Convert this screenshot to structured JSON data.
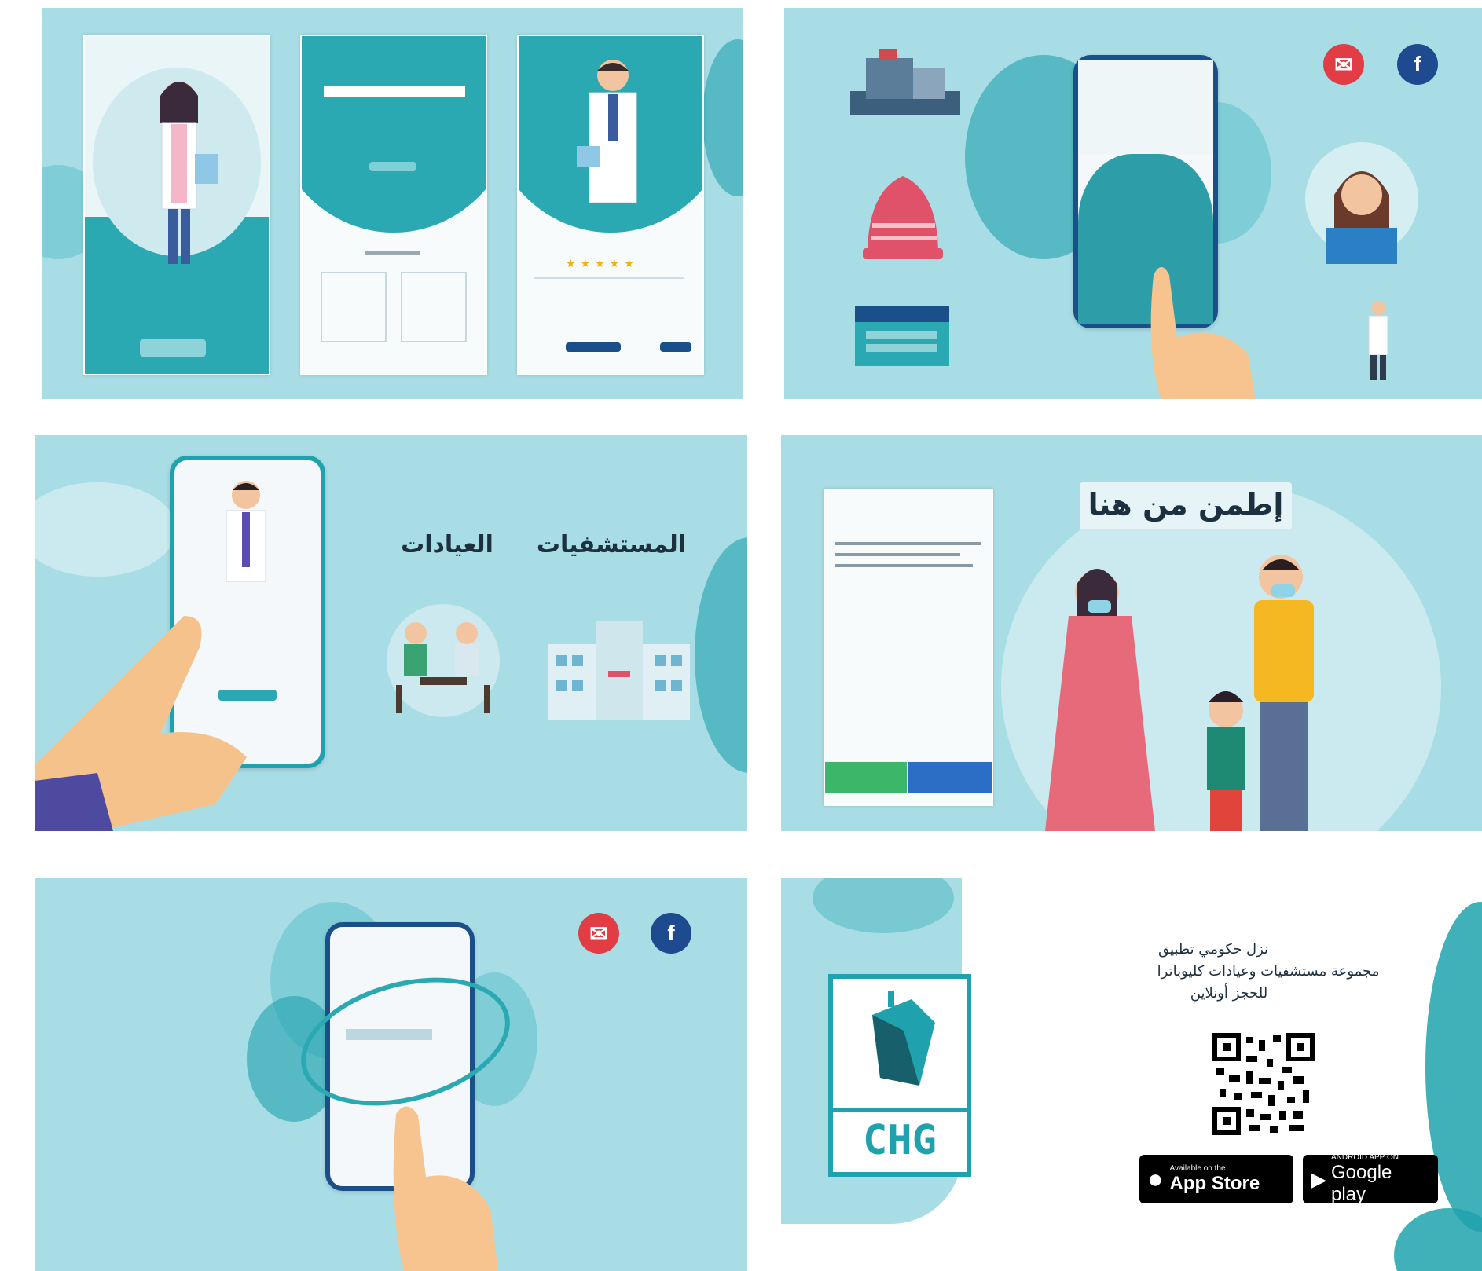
{
  "panel3": {
    "label_hospitals": "المستشفيات",
    "label_clinics": "العيادات"
  },
  "panel4": {
    "headline": "إطمن من هنا"
  },
  "panel6": {
    "line1": "نزل حكومي تطبيق",
    "line2": "مجموعة مستشفيات وعيادات كليوباترا",
    "line3": "للحجز أونلاين",
    "logo_text": "CHG",
    "app_store_small": "Available on the",
    "app_store_big": "App Store",
    "google_small": "ANDROID APP ON",
    "google_big": "Google play"
  },
  "icons": {
    "facebook_glyph": "f",
    "mail_glyph": "✉"
  },
  "colors": {
    "panel_bg": "#a9dde6",
    "teal": "#1fa2ad",
    "navy": "#1b4f8a",
    "facebook": "#1e4b8f",
    "mail": "#e23c44"
  }
}
